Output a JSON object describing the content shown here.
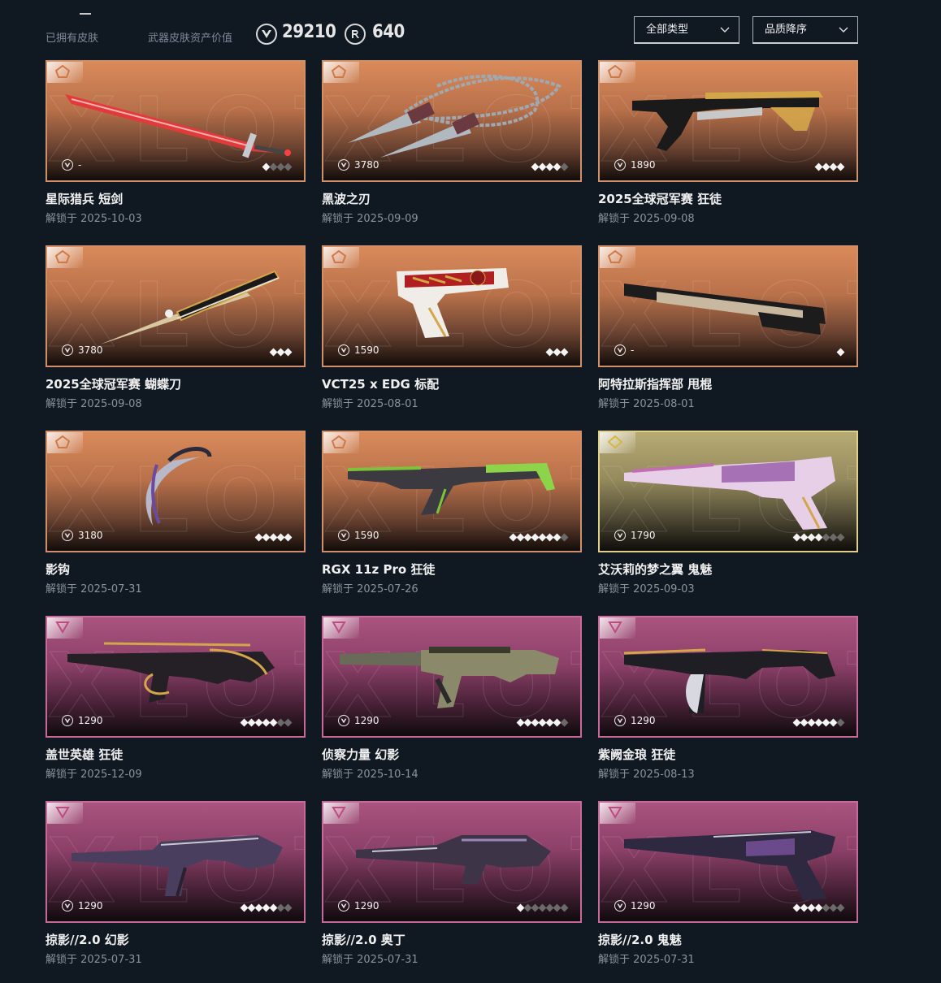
{
  "header": {
    "owned_label": "已拥有皮肤",
    "value_label": "武器皮肤资产价值",
    "vp_amount": "29210",
    "rp_amount": "640",
    "vp_icon": "valorant-points-icon",
    "rp_icon": "radianite-points-icon",
    "type_select": "全部类型",
    "sort_select": "品质降序"
  },
  "colors": {
    "background": "#101822",
    "tier_orange": "#d98a5a",
    "tier_gold": "#b7ab74",
    "tier_pink": "#a9547f"
  },
  "skins": [
    {
      "name": "星际猎兵 短剑",
      "date": "解锁于 2025-10-03",
      "price": "-",
      "tier": "orange",
      "levels": 4,
      "filled": 1
    },
    {
      "name": "黑波之刃",
      "date": "解锁于 2025-09-09",
      "price": "3780",
      "tier": "orange",
      "levels": 5,
      "filled": 4
    },
    {
      "name": "2025全球冠军赛 狂徒",
      "date": "解锁于 2025-09-08",
      "price": "1890",
      "tier": "orange",
      "levels": 4,
      "filled": 4
    },
    {
      "name": "2025全球冠军赛 蝴蝶刀",
      "date": "解锁于 2025-09-08",
      "price": "3780",
      "tier": "orange",
      "levels": 3,
      "filled": 3
    },
    {
      "name": "VCT25 x EDG 标配",
      "date": "解锁于 2025-08-01",
      "price": "1590",
      "tier": "orange",
      "levels": 3,
      "filled": 3
    },
    {
      "name": "阿特拉斯指挥部 甩棍",
      "date": "解锁于 2025-08-01",
      "price": "-",
      "tier": "orange",
      "levels": 1,
      "filled": 1
    },
    {
      "name": "影钩",
      "date": "解锁于 2025-07-31",
      "price": "3180",
      "tier": "orange",
      "levels": 5,
      "filled": 5
    },
    {
      "name": "RGX 11z Pro 狂徒",
      "date": "解锁于 2025-07-26",
      "price": "1590",
      "tier": "orange",
      "levels": 8,
      "filled": 7
    },
    {
      "name": "艾沃莉的梦之翼 鬼魅",
      "date": "解锁于 2025-09-03",
      "price": "1790",
      "tier": "gold",
      "levels": 7,
      "filled": 4
    },
    {
      "name": "盖世英雄 狂徒",
      "date": "解锁于 2025-12-09",
      "price": "1290",
      "tier": "pink",
      "levels": 7,
      "filled": 5
    },
    {
      "name": "侦察力量 幻影",
      "date": "解锁于 2025-10-14",
      "price": "1290",
      "tier": "pink",
      "levels": 7,
      "filled": 6
    },
    {
      "name": "紫阙金琅 狂徒",
      "date": "解锁于 2025-08-13",
      "price": "1290",
      "tier": "pink",
      "levels": 7,
      "filled": 6
    },
    {
      "name": "掠影//2.0 幻影",
      "date": "解锁于 2025-07-31",
      "price": "1290",
      "tier": "pink",
      "levels": 7,
      "filled": 5
    },
    {
      "name": "掠影//2.0 奥丁",
      "date": "解锁于 2025-07-31",
      "price": "1290",
      "tier": "pink",
      "levels": 7,
      "filled": 1
    },
    {
      "name": "掠影//2.0 鬼魅",
      "date": "解锁于 2025-07-31",
      "price": "1290",
      "tier": "pink",
      "levels": 7,
      "filled": 4
    }
  ]
}
